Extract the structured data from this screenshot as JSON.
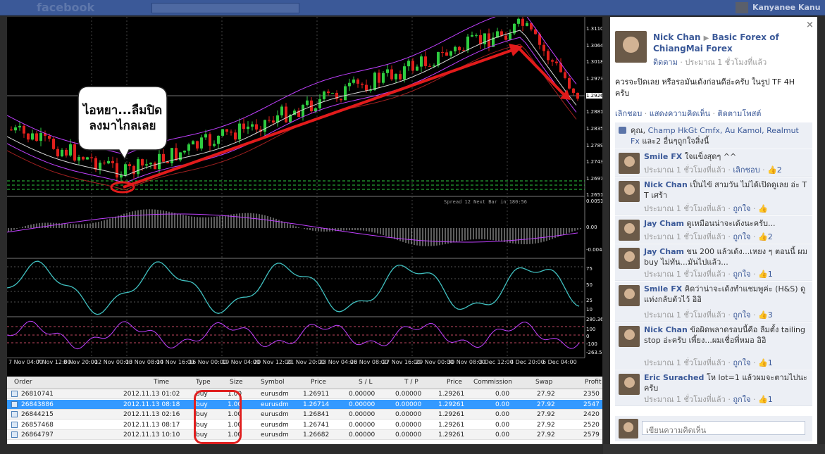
{
  "fb_header": {
    "logo": "facebook",
    "user_name": "Kanyanee Kanu"
  },
  "chart": {
    "price_labels": [
      "1.31100",
      "1.30640",
      "1.30180",
      "1.29730",
      "1.29261",
      "1.28810",
      "1.28350",
      "1.27890",
      "1.27430",
      "1.26970",
      "1.26510"
    ],
    "macd_labels": [
      "0.00516",
      "0.00",
      "-0.00476"
    ],
    "stoch_labels": [
      "75",
      "50",
      "25",
      "10"
    ],
    "cci_labels": [
      "280.365",
      "100",
      "0",
      "-100",
      "-263.559"
    ],
    "spread_text": "Spread 12  Next Bar in 180:56",
    "x_labels": [
      "7 Nov 04:00",
      "7 Nov 12:00",
      "8 Nov 20:00",
      "12 Nov 00:00",
      "13 Nov 08:00",
      "14 Nov 16:00",
      "16 Nov 00:00",
      "19 Nov 04:00",
      "20 Nov 12:00",
      "21 Nov 20:00",
      "23 Nov 04:00",
      "26 Nov 08:00",
      "27 Nov 16:00",
      "29 Nov 00:00",
      "30 Nov 08:00",
      "3 Dec 12:00",
      "4 Dec 20:00",
      "6 Dec 04:00"
    ],
    "bubble_text_line1": "ไอหยา...ลืมปิด",
    "bubble_text_line2": "ลงมาไกลเลย"
  },
  "terminal": {
    "headers": {
      "order": "Order",
      "time": "Time",
      "type": "Type",
      "size": "Size",
      "symbol": "Symbol",
      "price": "Price",
      "sl": "S / L",
      "tp": "T / P",
      "price2": "Price",
      "commission": "Commission",
      "swap": "Swap",
      "profit": "Profit"
    },
    "rows": [
      {
        "order": "26810741",
        "time": "2012.11.13 01:02",
        "type": "buy",
        "size": "1.00",
        "symbol": "eurusdm",
        "price": "1.26911",
        "sl": "0.00000",
        "tp": "0.00000",
        "price2": "1.29261",
        "commission": "0.00",
        "swap": "27.92",
        "profit": "2350"
      },
      {
        "order": "26843886",
        "time": "2012.11.13 08:18",
        "type": "buy",
        "size": "1.00",
        "symbol": "eurusdm",
        "price": "1.26714",
        "sl": "0.00000",
        "tp": "0.00000",
        "price2": "1.29261",
        "commission": "0.00",
        "swap": "27.92",
        "profit": "2547"
      },
      {
        "order": "26844215",
        "time": "2012.11.13 02:16",
        "type": "buy",
        "size": "1.00",
        "symbol": "eurusdm",
        "price": "1.26841",
        "sl": "0.00000",
        "tp": "0.00000",
        "price2": "1.29261",
        "commission": "0.00",
        "swap": "27.92",
        "profit": "2420"
      },
      {
        "order": "26857468",
        "time": "2012.11.13 08:17",
        "type": "buy",
        "size": "1.00",
        "symbol": "eurusdm",
        "price": "1.26741",
        "sl": "0.00000",
        "tp": "0.00000",
        "price2": "1.29261",
        "commission": "0.00",
        "swap": "27.92",
        "profit": "2520"
      },
      {
        "order": "26864797",
        "time": "2012.11.13 10:10",
        "type": "buy",
        "size": "1.00",
        "symbol": "eurusdm",
        "price": "1.26682",
        "sl": "0.00000",
        "tp": "0.00000",
        "price2": "1.29261",
        "commission": "0.00",
        "swap": "27.92",
        "profit": "2579"
      }
    ]
  },
  "post": {
    "author": "Nick Chan",
    "group": "Basic Forex of ChiangMai Forex",
    "follow": "ติดตาม",
    "time": "ประมาณ 1 ชั่วโมงที่แล้ว",
    "body": "ควรจะปิดเลย หรือรอมันเด้งก่อนดีอ่ะครับ ในรูป TF 4H ครับ",
    "action_unlike": "เลิกชอบ",
    "action_comment": "แสดงความคิดเห็น",
    "action_follow": "ติดตามโพสต์",
    "likes_prefix": "คุณ,",
    "likes_names": "Champ HkGt Cmfx, Au Kamol, Realmut Fx",
    "likes_suffix": "และ2 อื่นๆถูกใจสิ่งนี้",
    "close_label": "×",
    "composer_placeholder": "เขียนความคิดเห็น"
  },
  "comments": [
    {
      "name": "Smile FX",
      "text": "ใจแข็งสุดๆ ^^",
      "time": "ประมาณ 1 ชั่วโมงที่แล้ว",
      "like_label": "เลิกชอบ",
      "count": "2"
    },
    {
      "name": "Nick Chan",
      "text": "เป็นไข้ สามวัน ไม่ได้เปิดดูเลย อ่ะ T T เศร้า",
      "time": "ประมาณ 1 ชั่วโมงที่แล้ว",
      "like_label": "ถูกใจ",
      "count": ""
    },
    {
      "name": "Jay Cham",
      "text": "ดูเหมือนน่าจะเด้งนะครับ...",
      "time": "ประมาณ 1 ชั่วโมงที่แล้ว",
      "like_label": "ถูกใจ",
      "count": "2"
    },
    {
      "name": "Jay Cham",
      "text": "ขน 200 แล้วเด้ง...เหยง ๆ ตอนนี้ ผม buy ไม่ทัน...มันไปแล้ว...",
      "time": "ประมาณ 1 ชั่วโมงที่แล้ว",
      "like_label": "ถูกใจ",
      "count": "1"
    },
    {
      "name": "Smile FX",
      "text": "คิดว่าน่าจะเด้งทำแชมพูค่ะ (H&S) ดูแท่งกลับตัวไว้ อิอิ",
      "time": "ประมาณ 1 ชั่วโมงที่แล้ว",
      "like_label": "ถูกใจ",
      "count": "3"
    },
    {
      "name": "Nick Chan",
      "text": "ข้อผิดพลาดรอบนี้คือ ลืมตั้ง tailing stop อ่ะครับ เพี้ยง...ผมเชื่อพี่หมอ อิอิ",
      "time": "ประมาณ 1 ชั่วโมงที่แล้ว",
      "like_label": "ถูกใจ",
      "count": "1"
    },
    {
      "name": "Eric Surached",
      "text": "โห lot=1 แล้วผมจะตามไปนะครับ",
      "time": "ประมาณ 1 ชั่วโมงที่แล้ว",
      "like_label": "ถูกใจ",
      "count": "1"
    }
  ],
  "colors": {
    "fb_blue": "#3b5998",
    "arrow_red": "#e21b1b",
    "selection_blue": "#3399ff"
  }
}
